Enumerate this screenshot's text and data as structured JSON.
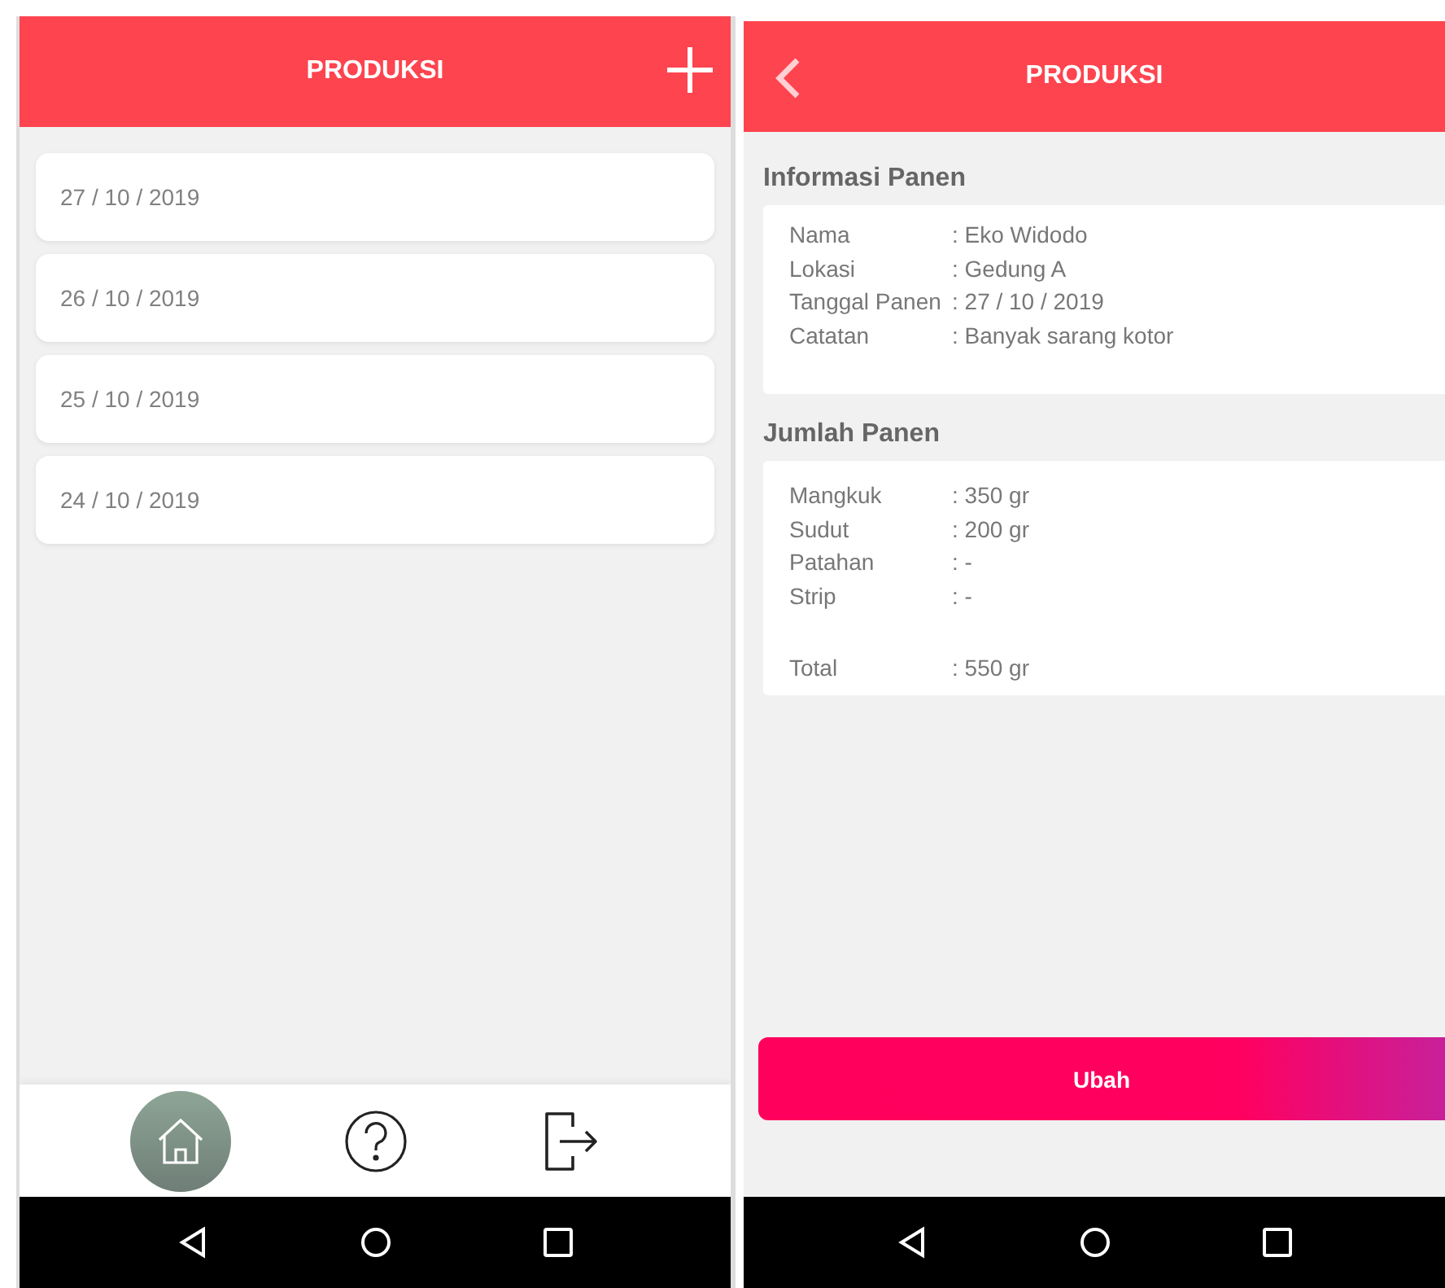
{
  "list_screen": {
    "title": "PRODUKSI",
    "dates": [
      "27 / 10 / 2019",
      "26 / 10 / 2019",
      "25 / 10 / 2019",
      "24 / 10 / 2019"
    ],
    "nav": [
      {
        "kind": "home",
        "selected": true
      },
      {
        "kind": "help",
        "selected": false
      },
      {
        "kind": "logout",
        "selected": false
      }
    ]
  },
  "detail_screen": {
    "title": "PRODUKSI",
    "sections": [
      {
        "heading": "Informasi Panen",
        "rows": [
          {
            "label": "Nama",
            "value": ": Eko Widodo"
          },
          {
            "label": "Lokasi",
            "value": ": Gedung A"
          },
          {
            "label": "Tanggal Panen",
            "value": ": 27 / 10 / 2019"
          },
          {
            "label": "Catatan",
            "value": ": Banyak sarang kotor"
          }
        ]
      },
      {
        "heading": "Jumlah Panen",
        "rows": [
          {
            "label": "Mangkuk",
            "value": ": 350 gr"
          },
          {
            "label": "Sudut",
            "value": ": 200 gr"
          },
          {
            "label": "Patahan",
            "value": ":  -"
          },
          {
            "label": "Strip",
            "value": ":  -"
          }
        ],
        "total": {
          "label": "Total",
          "value": ": 550 gr"
        }
      }
    ],
    "button": "Ubah"
  }
}
